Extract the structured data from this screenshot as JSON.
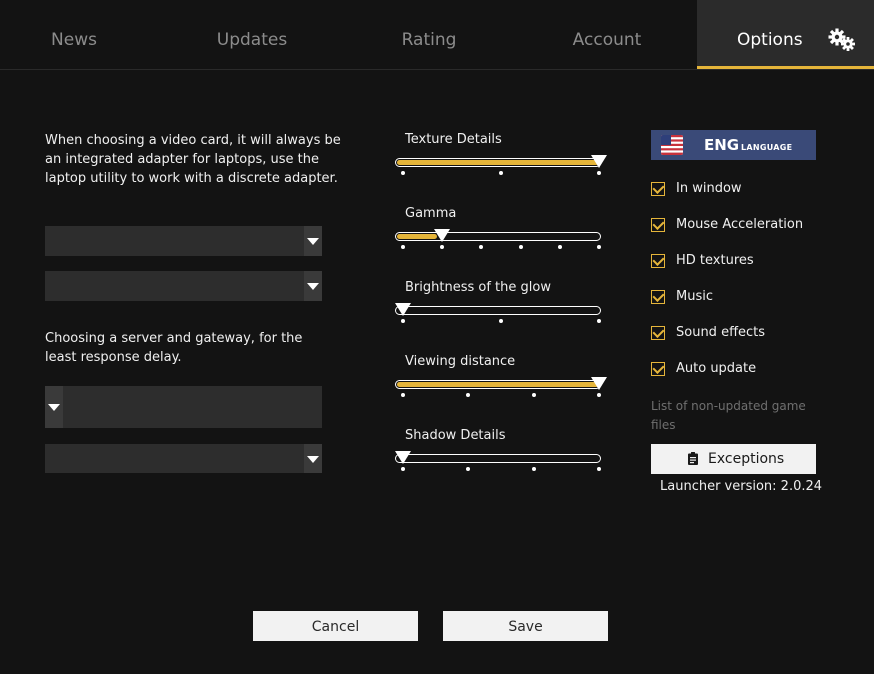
{
  "nav": {
    "tabs": [
      {
        "label": "News"
      },
      {
        "label": "Updates"
      },
      {
        "label": "Rating"
      },
      {
        "label": "Account"
      },
      {
        "label": "Options"
      }
    ],
    "active_tab": "Options",
    "settings_icon": "gears-icon"
  },
  "video": {
    "note": "When choosing a video card, it will always be an integrated adapter for laptops, use the laptop utility to work with a discrete adapter."
  },
  "server": {
    "note": "Choosing a server and gateway, for the least response delay."
  },
  "sliders": [
    {
      "label": "Texture Details",
      "value_fraction": 1.0,
      "steps": 3,
      "selected_step": 3
    },
    {
      "label": "Gamma",
      "value_fraction": 0.2,
      "steps": 6,
      "selected_step": 2
    },
    {
      "label": "Brightness of the glow",
      "value_fraction": 0.0,
      "steps": 3,
      "selected_step": 1
    },
    {
      "label": "Viewing distance",
      "value_fraction": 1.0,
      "steps": 4,
      "selected_step": 4
    },
    {
      "label": "Shadow Details",
      "value_fraction": 0.0,
      "steps": 4,
      "selected_step": 1
    }
  ],
  "language": {
    "code": "ENG",
    "word": "LANGUAGE",
    "flag_icon": "us-flag-icon"
  },
  "options": [
    {
      "label": "In window",
      "checked": true
    },
    {
      "label": "Mouse Acceleration",
      "checked": true
    },
    {
      "label": "HD textures",
      "checked": true
    },
    {
      "label": "Music",
      "checked": true
    },
    {
      "label": "Sound effects",
      "checked": true
    },
    {
      "label": "Auto update",
      "checked": true
    }
  ],
  "exceptions": {
    "note": "List of non-updated game files",
    "button_label": "Exceptions",
    "icon": "clipboard-icon"
  },
  "launcher": {
    "version_text": "Launcher version: 2.0.24"
  },
  "footer": {
    "cancel_label": "Cancel",
    "save_label": "Save"
  },
  "colors": {
    "accent": "#e5b53a",
    "background": "#131313",
    "language_button": "#3a4a78"
  }
}
